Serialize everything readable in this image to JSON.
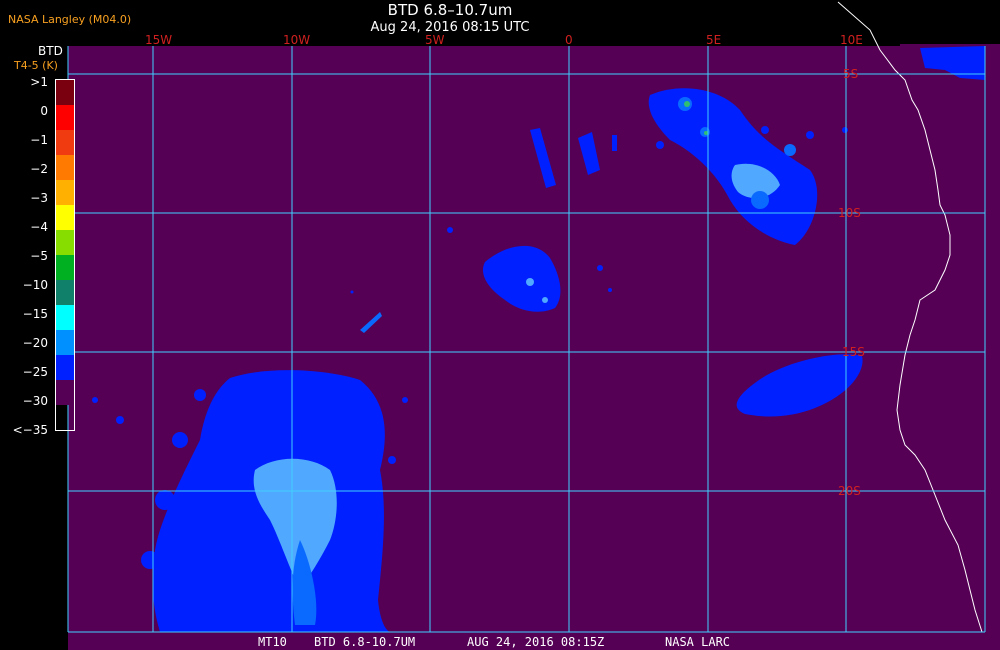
{
  "header": {
    "org": "NASA Langley (M04.0)",
    "title": "BTD 6.8–10.7um",
    "subtitle": "Aug 24, 2016 08:15 UTC"
  },
  "legend": {
    "title": "BTD",
    "units": "T4-5 (K)",
    "items": [
      {
        "label": ">1",
        "color": "#7a0010"
      },
      {
        "label": "0",
        "color": "#ff0000"
      },
      {
        "label": "−1",
        "color": "#f03a10"
      },
      {
        "label": "−2",
        "color": "#ff7a00"
      },
      {
        "label": "−3",
        "color": "#ffb000"
      },
      {
        "label": "−4",
        "color": "#ffff00"
      },
      {
        "label": "−5",
        "color": "#88dd00"
      },
      {
        "label": "−10",
        "color": "#00b020"
      },
      {
        "label": "−15",
        "color": "#10806a"
      },
      {
        "label": "−20",
        "color": "#00ffff"
      },
      {
        "label": "−25",
        "color": "#0090ff"
      },
      {
        "label": "−30",
        "color": "#0020ff"
      },
      {
        "label": "<−35",
        "color": "#550055"
      }
    ]
  },
  "grid": {
    "lon_labels": [
      "15W",
      "10W",
      "5W",
      "0",
      "5E",
      "10E"
    ],
    "lat_labels": [
      "5S",
      "10S",
      "15S",
      "20S"
    ],
    "line_color": "#40d0ff",
    "label_color": "#d02020"
  },
  "colors": {
    "background": "#550055",
    "cloud_cold": "#0020ff",
    "cloud_mid": "#0a6aff",
    "cloud_light": "#50a8ff",
    "coast": "#ffffff"
  },
  "footer": {
    "sat": "MT10",
    "product": "BTD 6.8-10.7UM",
    "datetime": "AUG 24, 2016 08:15Z",
    "agency": "NASA LARC"
  }
}
